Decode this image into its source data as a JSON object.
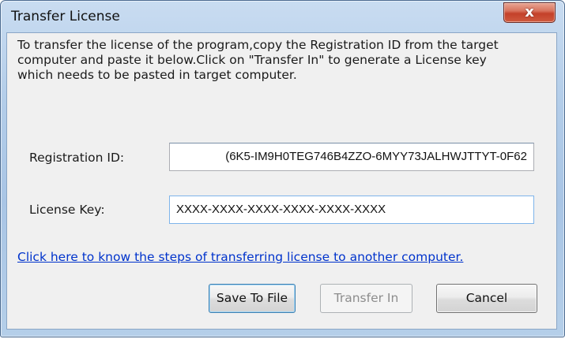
{
  "window": {
    "title": "Transfer License",
    "close_glyph": "x"
  },
  "description": {
    "line1": "To transfer the license of the program,copy the Registration ID from the target",
    "line2": "computer and paste it below.Click on \"Transfer In\" to generate a License key",
    "line3": "which needs to be pasted in target computer."
  },
  "registration": {
    "label": "Registration ID:",
    "value": "(6K5-IM9H0TEG746B4ZZO-6MYY73JALHWJTTYT-0F62"
  },
  "license": {
    "label": "License Key:",
    "value": "XXXX-XXXX-XXXX-XXXX-XXXX-XXXX"
  },
  "help_link": {
    "text": "Click here to know the steps of transferring license to another computer."
  },
  "buttons": {
    "save": "Save To File",
    "transfer": "Transfer In",
    "cancel": "Cancel"
  },
  "colors": {
    "link": "#0033cc",
    "close_button": "#c4412a",
    "title_bar": "#b3cde9",
    "client_background": "#f0f0f0"
  },
  "icons": {
    "close": "close-icon"
  }
}
